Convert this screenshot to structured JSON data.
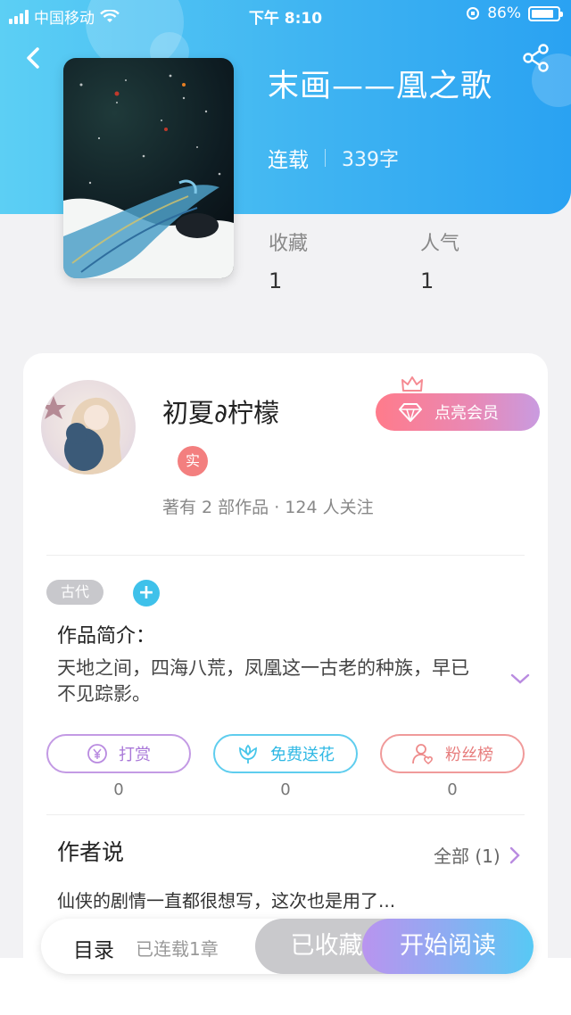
{
  "status_bar": {
    "carrier": "中国移动",
    "time": "下午 8:10",
    "battery": "86%",
    "battery_level": 0.86
  },
  "book": {
    "title": "末画——凰之歌",
    "status": "连载",
    "word_count": "339字",
    "stats": [
      {
        "label": "收藏",
        "value": "1"
      },
      {
        "label": "人气",
        "value": "1"
      }
    ]
  },
  "author": {
    "name": "初夏∂柠檬",
    "badge": "实",
    "subtitle": "著有 2 部作品 · 124 人关注",
    "vip_button": "点亮会员"
  },
  "tags": [
    "古代"
  ],
  "intro": {
    "title": "作品简介：",
    "text": "天地之间，四海八荒，凤凰这一古老的种族，早已不见踪影。"
  },
  "actions": [
    {
      "label": "打赏",
      "count": "0",
      "color": "#b98be0"
    },
    {
      "label": "免费送花",
      "count": "0",
      "color": "#47c6ea"
    },
    {
      "label": "粉丝榜",
      "count": "0",
      "color": "#ee8a8a"
    }
  ],
  "author_says": {
    "title": "作者说",
    "all_label": "全部 (1)",
    "text": "仙侠的剧情一直都很想写，这次也是用了..."
  },
  "bottom_bar": {
    "toc": "目录",
    "toc_sub": "已连载1章",
    "collected": "已收藏",
    "read": "开始阅读"
  },
  "colors": {
    "header_start": "#5ccff4",
    "header_end": "#2aa2f2",
    "accent_purple": "#b994ef"
  },
  "icons": [
    "back-icon",
    "share-icon",
    "wifi-icon",
    "battery-icon",
    "crown-icon",
    "diamond-icon",
    "add-icon",
    "chevron-down-icon",
    "chevron-right-icon",
    "yen-icon",
    "flower-icon",
    "fan-icon"
  ]
}
